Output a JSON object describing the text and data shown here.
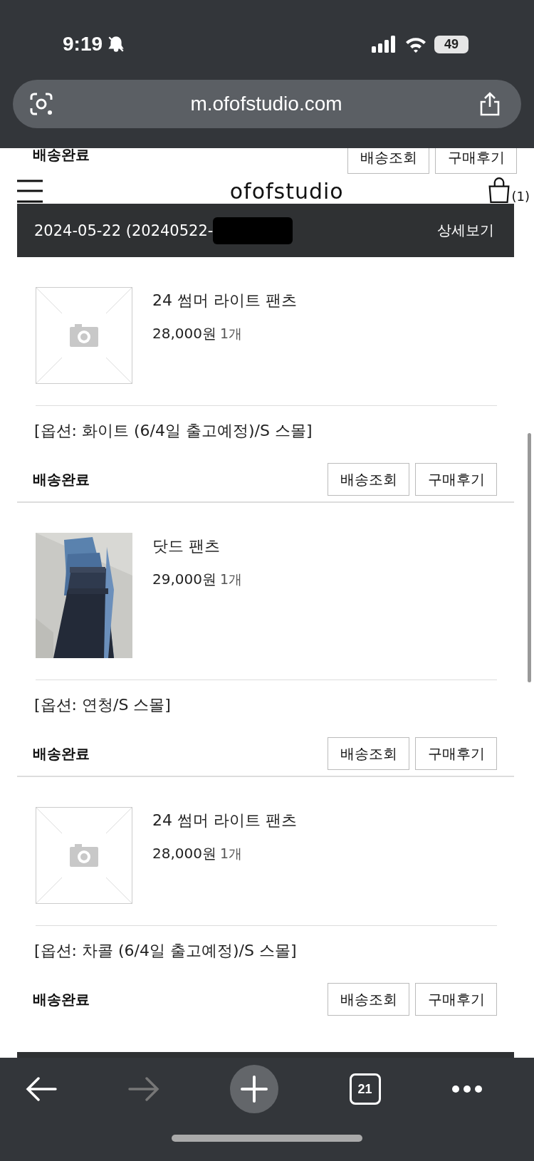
{
  "status_bar": {
    "time": "9:19",
    "battery": "49"
  },
  "address_bar": {
    "url": "m.ofofstudio.com"
  },
  "partial_row": {
    "status": "배송완료",
    "buttons": [
      "배송조회",
      "구매후기"
    ]
  },
  "site_header": {
    "logo": "ofofstudio",
    "cart_count": "(1)"
  },
  "order": {
    "date": "2024-05-22 (20240522-",
    "redacted": true,
    "detail_link": "상세보기"
  },
  "items": [
    {
      "image": {
        "kind": "placeholder"
      },
      "name": "24 썸머 라이트 팬츠",
      "price": "28,000원",
      "quantity": "1개",
      "option": "[옵션: 화이트 (6/4일 출고예정)/S 스몰]",
      "status": "배송완료",
      "buttons": [
        "배송조회",
        "구매후기"
      ]
    },
    {
      "image": {
        "kind": "picture"
      },
      "name": "닷드 팬츠",
      "price": "29,000원",
      "quantity": "1개",
      "option": "[옵션: 연청/S 스몰]",
      "status": "배송완료",
      "buttons": [
        "배송조회",
        "구매후기"
      ]
    },
    {
      "image": {
        "kind": "placeholder"
      },
      "name": "24 썸머 라이트 팬츠",
      "price": "28,000원",
      "quantity": "1개",
      "option": "[옵션: 차콜 (6/4일 출고예정)/S 스몰]",
      "status": "배송완료",
      "buttons": [
        "배송조회",
        "구매후기"
      ]
    }
  ],
  "toolbar": {
    "tabs_count": "21"
  }
}
